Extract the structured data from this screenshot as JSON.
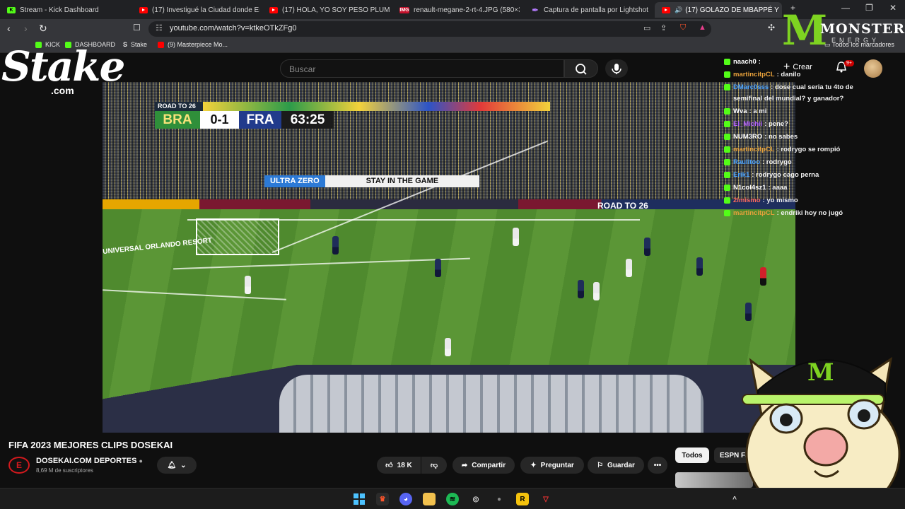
{
  "tabs": [
    {
      "title": "Stream - Kick Dashboard",
      "icon": "kick-icon"
    },
    {
      "title": "(17) Investigué la Ciudad donde Esca",
      "icon": "youtube-icon"
    },
    {
      "title": "(17) HOLA, YO SOY PESO PLUMA // I",
      "icon": "youtube-icon"
    },
    {
      "title": "renault-megane-2-rt-4.JPG (580×31",
      "icon": "image-icon"
    },
    {
      "title": "Captura de pantalla por Lightshot",
      "icon": "lightshot-icon"
    },
    {
      "title": "(17) GOLAZO DE MBAPPÉ Y",
      "icon": "youtube-icon",
      "active": true
    }
  ],
  "address_bar": {
    "url": "youtube.com/watch?v=ktkeOTkZFg0"
  },
  "bookmarks": [
    {
      "label": "KICK"
    },
    {
      "label": "DASHBOARD"
    },
    {
      "label": "Stake"
    },
    {
      "label": "(9) Masterpiece Mo..."
    }
  ],
  "all_bookmarks_label": "Todos los marcadores",
  "youtube": {
    "search_placeholder": "Buscar",
    "create_label": "Crear",
    "notifications_badge": "9+"
  },
  "scoreboard": {
    "tag": "ROAD TO 26",
    "home": "BRA",
    "score": "0-1",
    "away": "FRA",
    "clock": "63:25"
  },
  "stadium_boards": {
    "ultra_zero_brand": "ULTRA ZERO",
    "stay_in_game": "STAY IN THE GAME",
    "road26": "ROAD TO 26",
    "orlando": "UNIVERSAL ORLANDO RESORT"
  },
  "overlays": {
    "stake_logo": "Stake",
    "stake_domain": ".com",
    "monster_name": "MONSTER",
    "monster_sub": "ENERGY"
  },
  "chat": [
    {
      "user": "naach0",
      "text": ": ",
      "color": "#ffffff"
    },
    {
      "user": "martincitpCL",
      "text": ": danilo",
      "color": "#e8a13b"
    },
    {
      "user": "DMarc0sss",
      "text": ": dose cual seria tu 4to de",
      "color": "#4aa3ff"
    },
    {
      "user": "",
      "text": "semifinal del mundial? y ganador?",
      "color": "#ffffff"
    },
    {
      "user": "Wva",
      "text": ": a mi",
      "color": "#ffffff"
    },
    {
      "user": "El_Michii",
      "text": ": pene?",
      "color": "#b25fff"
    },
    {
      "user": "NUM3RO",
      "text": ": no sabes",
      "color": "#ffffff"
    },
    {
      "user": "martincitpCL",
      "text": ": rodrygo se rompió",
      "color": "#e8a13b"
    },
    {
      "user": "Raulitoo",
      "text": ": rodrygo",
      "color": "#4aa3ff"
    },
    {
      "user": "Erik1",
      "text": ": rodrygo cago perna",
      "color": "#4aa3ff"
    },
    {
      "user": "N1col4sz1",
      "text": ": aaaa",
      "color": "#ffffff"
    },
    {
      "user": "2lmismo",
      "text": ": yo mismo",
      "color": "#ff6a5b"
    },
    {
      "user": "martincitpCL",
      "text": ": endriki hoy no jugó",
      "color": "#e8a13b"
    }
  ],
  "video_info": {
    "title": "FIFA 2023 MEJORES CLIPS DOSEKAI",
    "channel": "DOSEKAI.COM DEPORTES",
    "subscribers": "8,69 M de suscriptores",
    "likes": "18 K",
    "share_label": "Compartir",
    "ask_label": "Preguntar",
    "save_label": "Guardar"
  },
  "chips": [
    {
      "label": "Todos"
    },
    {
      "label": "ESPN Fa"
    }
  ]
}
